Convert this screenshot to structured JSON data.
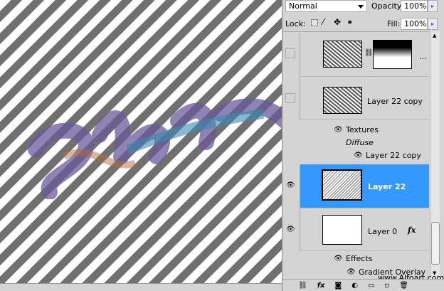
{
  "blend_mode": "Normal",
  "opacity_label": "Opacity:",
  "opacity": "100%",
  "lock_label": "Lock:",
  "fill_label": "Fill:",
  "fill": "100%",
  "layers": {
    "top_more": "...",
    "layer22copy": "Layer 22 copy",
    "textures": "Textures",
    "diffuse": "Diffuse",
    "layer22copy_effect": "Layer 22 copy",
    "layer22": "Layer 22",
    "layer0": "Layer 0",
    "fx": "fx",
    "effects": "Effects",
    "gradient_overlay": "Gradient Overlay"
  },
  "watermark": "www.Alfoart.com",
  "colors": {
    "selected": "#3399ff"
  }
}
